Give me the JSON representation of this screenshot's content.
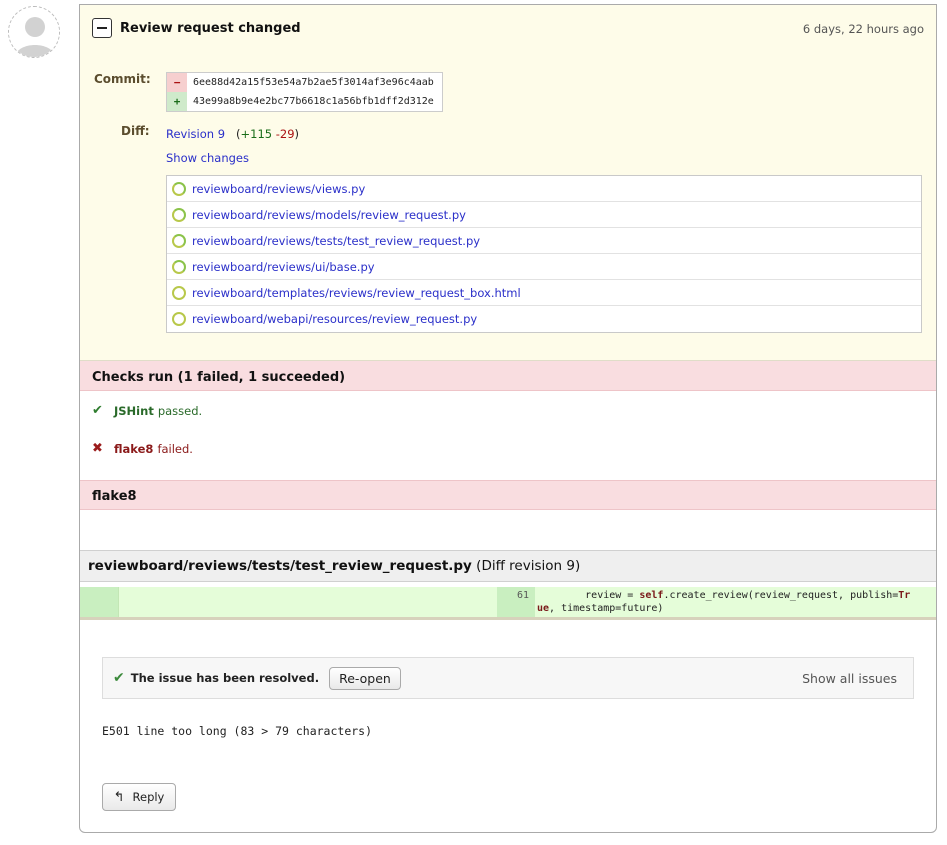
{
  "review": {
    "title": "Review request changed",
    "timestamp": "6 days, 22 hours ago",
    "commit_label": "Commit:",
    "commit_old_sign": "−",
    "commit_old": "6ee88d42a15f53e54a7b2ae5f3014af3e96c4aab",
    "commit_new_sign": "+",
    "commit_new": "43e99a8b9e4e2bc77b6618c1a56bfb1dff2d312e",
    "diff_label": "Diff:",
    "revision_link": "Revision 9",
    "added": "+115",
    "removed": "-29",
    "show_changes": "Show changes",
    "files": [
      "reviewboard/reviews/views.py",
      "reviewboard/reviews/models/review_request.py",
      "reviewboard/reviews/tests/test_review_request.py",
      "reviewboard/reviews/ui/base.py",
      "reviewboard/templates/reviews/review_request_box.html",
      "reviewboard/webapi/resources/review_request.py"
    ]
  },
  "checks": {
    "header": "Checks run (1 failed, 1 succeeded)",
    "jshint_name": "JSHint",
    "jshint_status": "passed.",
    "flake8_name": "flake8",
    "flake8_status": "failed."
  },
  "flake8_section": {
    "header": "flake8"
  },
  "diff_comment": {
    "file": "reviewboard/reviews/tests/test_review_request.py",
    "revision_note": "(Diff revision 9)",
    "line_number": "61",
    "code_pre": "        review = ",
    "code_kw1": "self",
    "code_mid": ".create_review(review_request, publish=",
    "code_kw2": "Tr",
    "code_line2_kw": "ue",
    "code_line2_rest": ", timestamp=future)"
  },
  "issue": {
    "status_text": "The issue has been resolved.",
    "reopen_label": "Re-open",
    "show_all_label": "Show all issues",
    "description": "E501 line too long (83 > 79 characters)",
    "reply_label": "Reply"
  },
  "icons": {
    "check": "✔",
    "cross": "✖",
    "reply": "↰"
  },
  "colors": {
    "link": "#2a2fc9",
    "header_bg": "#fefce9",
    "failure_bg": "#f9dde0",
    "diff_insert_bg": "#e5fdd9"
  }
}
